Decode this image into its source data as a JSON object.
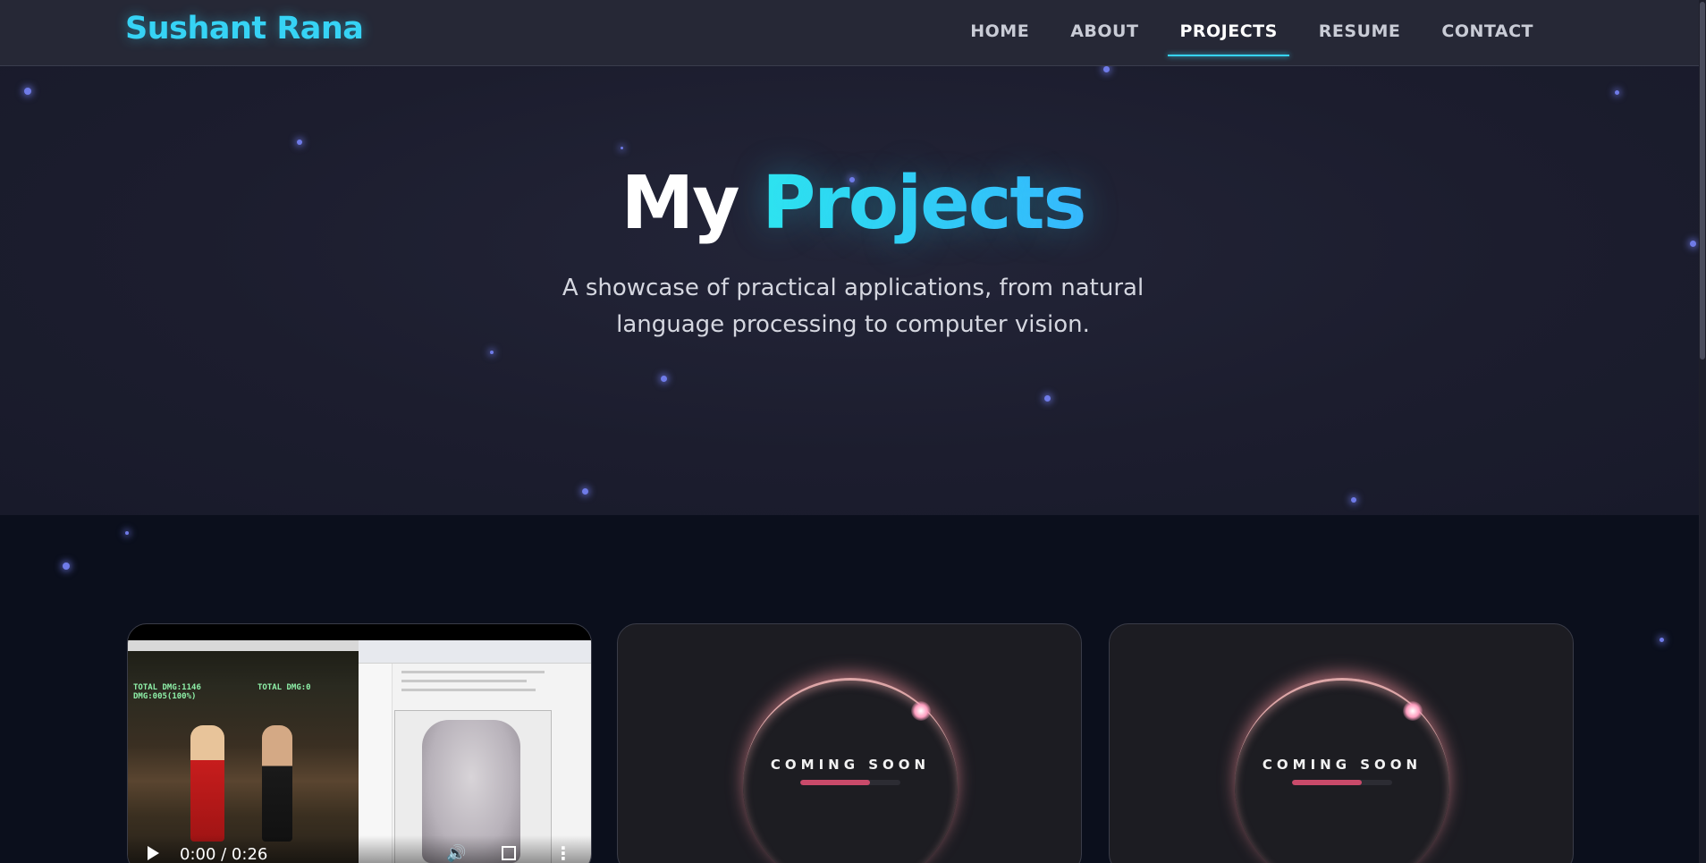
{
  "nav": {
    "brand": "Sushant Rana",
    "links": [
      {
        "label": "HOME",
        "active": false
      },
      {
        "label": "ABOUT",
        "active": false
      },
      {
        "label": "PROJECTS",
        "active": true
      },
      {
        "label": "RESUME",
        "active": false
      },
      {
        "label": "CONTACT",
        "active": false
      }
    ]
  },
  "hero": {
    "title_part1": "My",
    "title_part2": "Projects",
    "subtitle": "A showcase of practical applications, from natural language processing to computer vision."
  },
  "projects": {
    "video_card": {
      "hud_left": "TOTAL DMG:1146\nDMG:005(100%)",
      "hud_right": "TOTAL DMG:0",
      "time": "0:00 / 0:26",
      "icons": [
        "play-icon",
        "volume-icon",
        "fullscreen-icon",
        "more-options-icon"
      ]
    },
    "coming_soon_cards": [
      {
        "label": "COMING SOON",
        "progress": 0.7
      },
      {
        "label": "COMING SOON",
        "progress": 0.7
      }
    ]
  },
  "colors": {
    "accent": "#36d3f5",
    "hero_bg": "#1c1d2e",
    "section_bg": "#0b0f1c",
    "progress": "#c94a6a",
    "particle": "#6f7be8"
  }
}
